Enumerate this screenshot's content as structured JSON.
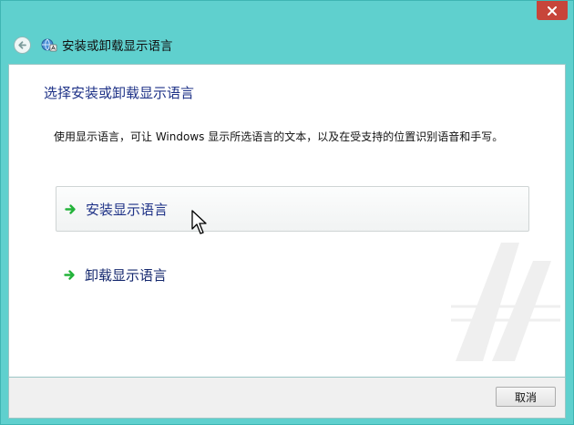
{
  "window": {
    "title": "安装或卸载显示语言",
    "accent_color": "#5fd0ce",
    "close_color": "#c7453a"
  },
  "main": {
    "heading": "选择安装或卸载显示语言",
    "description": "使用显示语言，可让 Windows 显示所选语言的文本，以及在受支持的位置识别语音和手写。",
    "options": [
      {
        "label": "安装显示语言",
        "icon": "green-arrow-icon",
        "hovered": true
      },
      {
        "label": "卸载显示语言",
        "icon": "green-arrow-icon",
        "hovered": false
      }
    ]
  },
  "footer": {
    "cancel_label": "取消"
  }
}
